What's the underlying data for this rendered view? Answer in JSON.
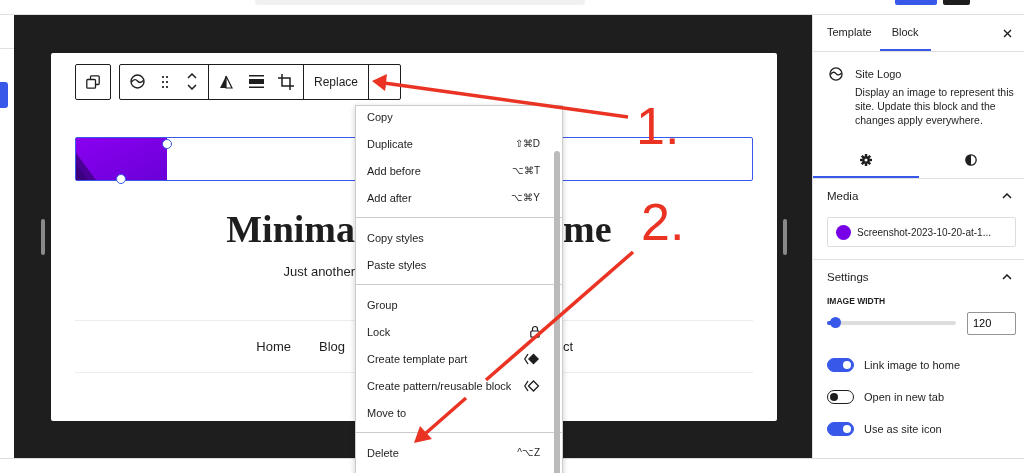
{
  "editor_toolbar": {
    "replace_label": "Replace"
  },
  "page": {
    "title_left": "Minima",
    "title_right": "me",
    "tagline": "Just another",
    "nav_left": [
      "Home",
      "Blog"
    ],
    "nav_right": [
      "ct"
    ]
  },
  "block_menu": {
    "groups": [
      [
        {
          "label": "Copy",
          "kind": "plain"
        },
        {
          "label": "Duplicate",
          "kind": "shortcut",
          "shortcut": "⇧⌘D"
        },
        {
          "label": "Add before",
          "kind": "shortcut",
          "shortcut": "⌥⌘T"
        },
        {
          "label": "Add after",
          "kind": "shortcut",
          "shortcut": "⌥⌘Y"
        }
      ],
      [
        {
          "label": "Copy styles",
          "kind": "plain"
        },
        {
          "label": "Paste styles",
          "kind": "plain"
        }
      ],
      [
        {
          "label": "Group",
          "kind": "plain"
        },
        {
          "label": "Lock",
          "kind": "icon"
        },
        {
          "label": "Create template part",
          "kind": "icon"
        },
        {
          "label": "Create pattern/reusable block",
          "kind": "icon"
        },
        {
          "label": "Move to",
          "kind": "plain"
        }
      ],
      [
        {
          "label": "Delete",
          "kind": "shortcut",
          "shortcut": "^⌥Z"
        }
      ]
    ]
  },
  "annotations": [
    {
      "label": "1."
    },
    {
      "label": "2."
    }
  ],
  "sidebar": {
    "tabs": [
      {
        "label": "Template",
        "selected": false
      },
      {
        "label": "Block",
        "selected": true
      }
    ],
    "block_card": {
      "title": "Site Logo",
      "description": "Display an image to represent this site. Update this block and the changes apply everywhere."
    },
    "icon_tabs": [
      {
        "selected": true
      },
      {
        "selected": false
      }
    ],
    "media": {
      "title": "Media",
      "expanded": true,
      "file": "Screenshot-2023-10-20-at-1..."
    },
    "settings": {
      "title": "Settings",
      "expanded": true,
      "width_label": "IMAGE WIDTH",
      "level": 0.06,
      "width_value": "120",
      "toggles": [
        {
          "label": "Link image to home",
          "on": true
        },
        {
          "label": "Open in new tab",
          "on": false
        },
        {
          "label": "Use as site icon",
          "on": true
        }
      ]
    }
  }
}
